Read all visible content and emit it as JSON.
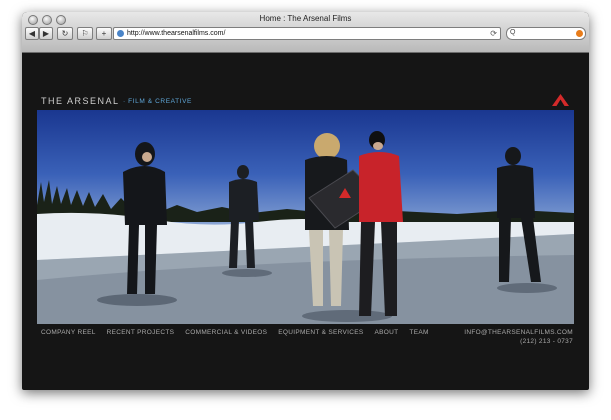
{
  "browser": {
    "title": "Home : The Arsenal Films",
    "url": "http://www.thearsenalfilms.com/",
    "search_icon_glyph": "Q",
    "buttons": {
      "back": "◀",
      "forward": "▶",
      "reload": "↻",
      "bookmark": "⚐",
      "add": "+"
    }
  },
  "site": {
    "brand": "THE ARSENAL",
    "tagline": "· FILM & CREATIVE",
    "accent": "#d42a2a",
    "nav": [
      "COMPANY REEL",
      "RECENT PROJECTS",
      "COMMERCIAL & VIDEOS",
      "EQUIPMENT & SERVICES",
      "ABOUT",
      "TEAM"
    ],
    "email": "INFO@THEARSENALFILMS.COM",
    "phone": "(212) 213 - 0737"
  },
  "icons": [
    "globe-icon",
    "search-icon",
    "snapback-icon",
    "arsenal-logo-icon"
  ]
}
